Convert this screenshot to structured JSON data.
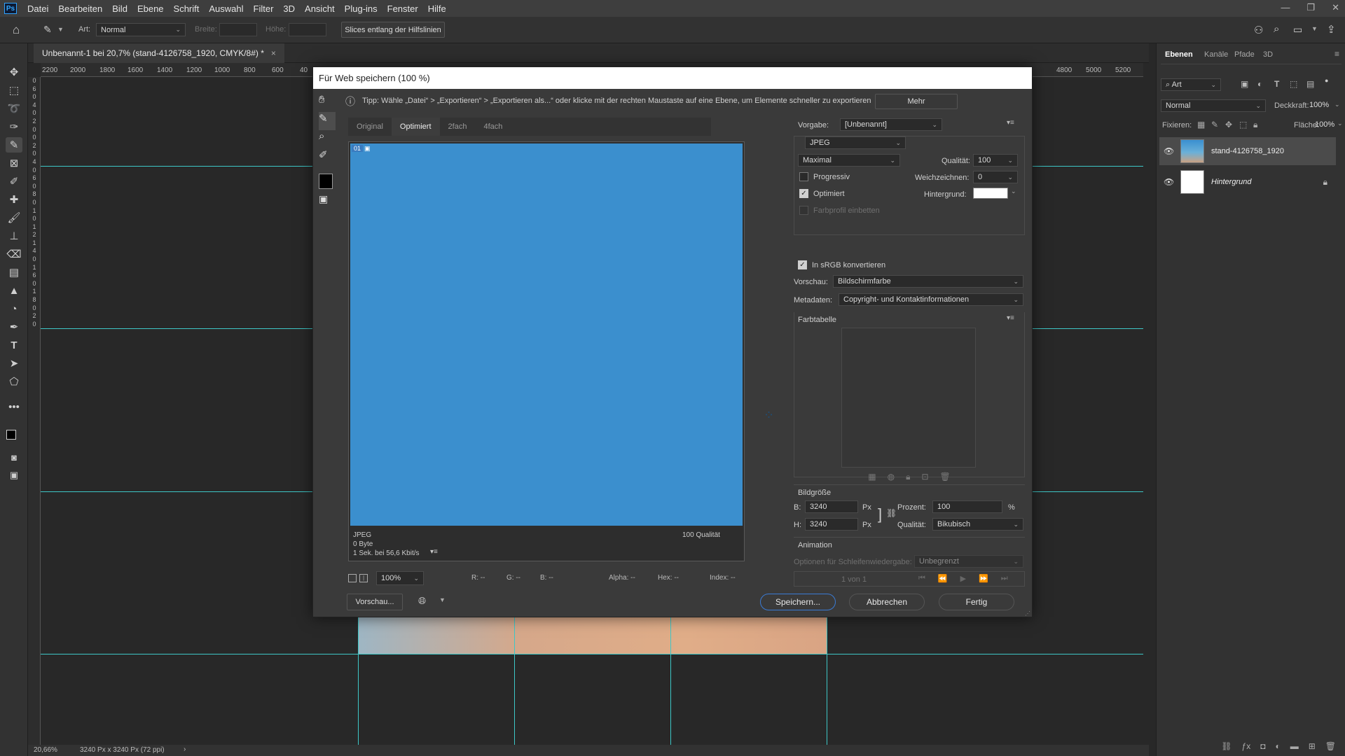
{
  "app": {
    "logo": "Ps",
    "menu": [
      "Datei",
      "Bearbeiten",
      "Bild",
      "Ebene",
      "Schrift",
      "Auswahl",
      "Filter",
      "3D",
      "Ansicht",
      "Plug-ins",
      "Fenster",
      "Hilfe"
    ]
  },
  "options": {
    "art_label": "Art:",
    "art_value": "Normal",
    "width_label": "Breite:",
    "height_label": "Höhe:",
    "slices_button": "Slices entlang der Hilfslinien"
  },
  "document": {
    "tab_title": "Unbenannt-1 bei 20,7% (stand-4126758_1920, CMYK/8#) *",
    "close": "×"
  },
  "ruler": {
    "h_ticks": [
      "2200",
      "2000",
      "1800",
      "1600",
      "1400",
      "1200",
      "1000",
      "800",
      "600",
      "40",
      "4800",
      "5000",
      "5200"
    ],
    "v_ticks": [
      "0",
      "6",
      "0",
      "4",
      "0",
      "2",
      "0",
      "0",
      "2",
      "0",
      "4",
      "0",
      "6",
      "0",
      "8",
      "0",
      "1",
      "0",
      "1",
      "2",
      "1",
      "4",
      "0",
      "1",
      "6",
      "0",
      "1",
      "8",
      "0",
      "2",
      "0"
    ]
  },
  "status": {
    "zoom": "20,66%",
    "size": "3240 Px x 3240 Px (72 ppi)",
    "arrow": "›"
  },
  "layers_panel": {
    "tabs": [
      "Ebenen",
      "Kanäle",
      "Pfade",
      "3D"
    ],
    "filter_label": "Art",
    "blend_mode": "Normal",
    "opacity_label": "Deckkraft:",
    "opacity_value": "100%",
    "lock_label": "Fixieren:",
    "fill_label": "Fläche:",
    "fill_value": "100%",
    "layers": [
      {
        "name": "stand-4126758_1920"
      },
      {
        "name": "Hintergrund"
      }
    ]
  },
  "dialog": {
    "title": "Für Web speichern (100 %)",
    "tip": "Tipp: Wähle „Datei“ > „Exportieren“ > „Exportieren als...“ oder klicke mit der rechten Maustaste auf eine Ebene, um Elemente schneller zu exportieren",
    "more_button": "Mehr",
    "view_tabs": [
      "Original",
      "Optimiert",
      "2fach",
      "4fach"
    ],
    "active_tab": "Optimiert",
    "preview_badge": "01",
    "preview_info": {
      "format": "JPEG",
      "size": "0 Byte",
      "speed": "1 Sek. bei 56,6 Kbit/s",
      "quality": "100 Qualität"
    },
    "zoom": "100%",
    "readouts": {
      "r": "R: --",
      "g": "G: --",
      "b": "B: --",
      "alpha": "Alpha: --",
      "hex": "Hex: --",
      "index": "Index: --"
    },
    "preview_button": "Vorschau...",
    "preset_label": "Vorgabe:",
    "preset_value": "[Unbenannt]",
    "format_value": "JPEG",
    "compression_value": "Maximal",
    "quality_label": "Qualität:",
    "quality_value": "100",
    "progressive_label": "Progressiv",
    "blur_label": "Weichzeichnen:",
    "blur_value": "0",
    "optimized_label": "Optimiert",
    "matte_label": "Hintergrund:",
    "embed_profile_label": "Farbprofil einbetten",
    "srgb_label": "In sRGB konvertieren",
    "preview_label": "Vorschau:",
    "preview_value": "Bildschirmfarbe",
    "metadata_label": "Metadaten:",
    "metadata_value": "Copyright- und Kontaktinformationen",
    "color_table_label": "Farbtabelle",
    "image_size_label": "Bildgröße",
    "width_label": "B:",
    "width_value": "3240",
    "height_label": "H:",
    "height_value": "3240",
    "unit": "Px",
    "percent_label": "Prozent:",
    "percent_value": "100",
    "percent_unit": "%",
    "resample_label": "Qualität:",
    "resample_value": "Bikubisch",
    "animation_label": "Animation",
    "loop_label": "Optionen für Schleifenwiedergabe:",
    "loop_value": "Unbegrenzt",
    "frame_counter": "1 von 1",
    "save_button": "Speichern...",
    "cancel_button": "Abbrechen",
    "done_button": "Fertig"
  },
  "colors": {
    "accent": "#3ec7c7",
    "preview_blue": "#3b8fce"
  }
}
